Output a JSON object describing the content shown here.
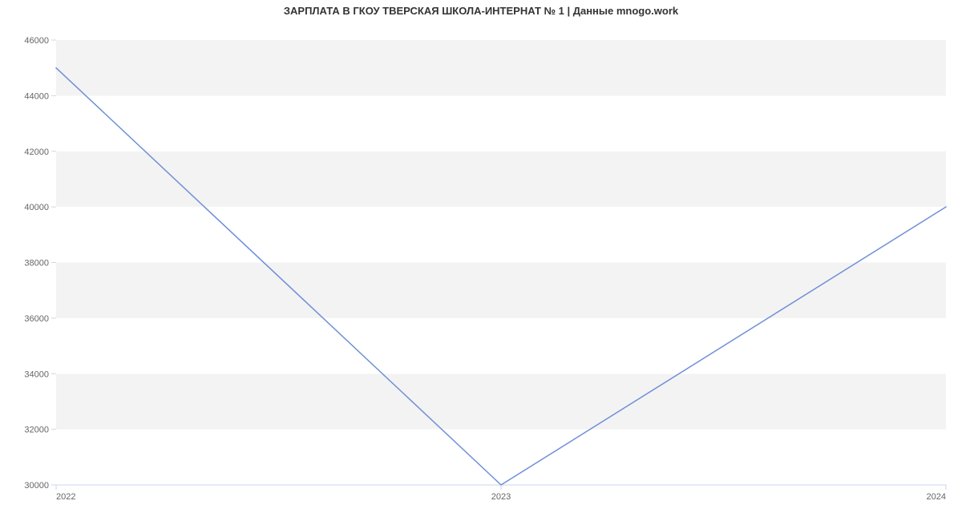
{
  "chart_data": {
    "type": "line",
    "title": "ЗАРПЛАТА В ГКОУ ТВЕРСКАЯ ШКОЛА-ИНТЕРНАТ № 1 | Данные mnogo.work",
    "categories": [
      "2022",
      "2023",
      "2024"
    ],
    "values": [
      45000,
      30000,
      40000
    ],
    "y_ticks": [
      30000,
      32000,
      34000,
      36000,
      38000,
      40000,
      42000,
      44000,
      46000
    ],
    "ylim": [
      30000,
      46000
    ],
    "xlabel": "",
    "ylabel": "",
    "line_color": "#6f8fd8",
    "band_color": "#f3f3f3",
    "axis_color": "#ccd6eb"
  }
}
